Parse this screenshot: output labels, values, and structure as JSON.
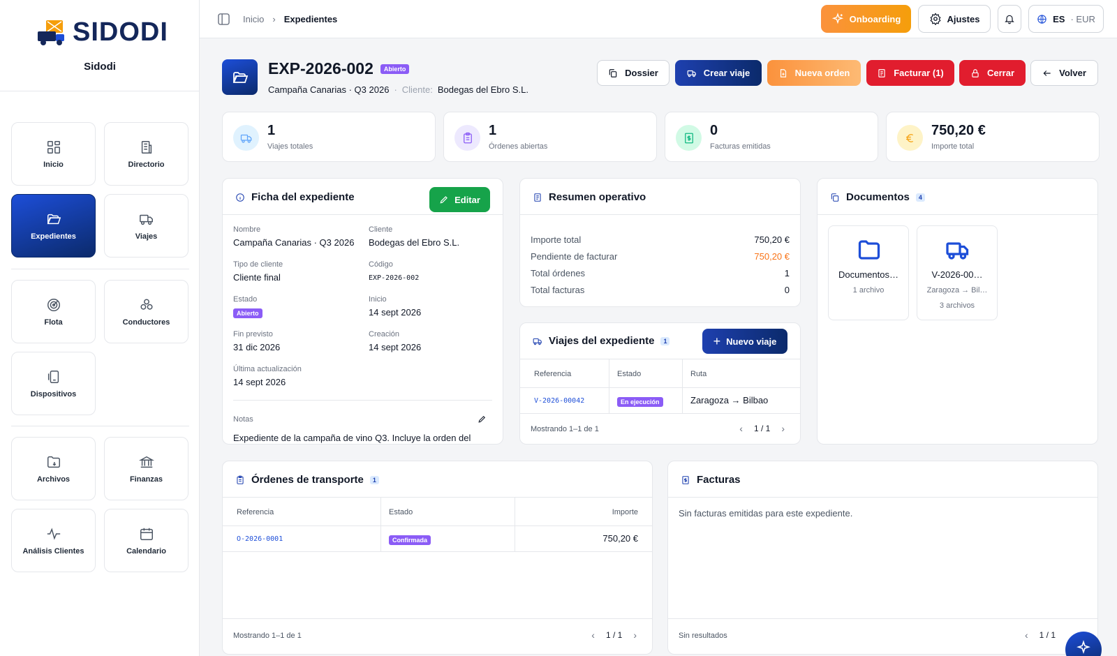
{
  "app": {
    "logo_text": "SIDODI",
    "brand_name": "Sidodi"
  },
  "nav": [
    {
      "label": "Inicio",
      "icon": "dashboard-icon",
      "active": false
    },
    {
      "label": "Directorio",
      "icon": "building-icon",
      "active": false
    },
    {
      "label": "Expedientes",
      "icon": "folder-open-icon",
      "active": true
    },
    {
      "label": "Viajes",
      "icon": "truck-icon",
      "active": false
    },
    {
      "label": "Flota",
      "icon": "radar-icon",
      "active": false
    },
    {
      "label": "Conductores",
      "icon": "people-icon",
      "active": false
    },
    {
      "label": "Dispositivos",
      "icon": "device-icon",
      "active": false
    },
    {
      "label": "Archivos",
      "icon": "folder-file-icon",
      "active": false
    },
    {
      "label": "Finanzas",
      "icon": "bank-icon",
      "active": false
    },
    {
      "label": "Análisis Clientes",
      "icon": "activity-icon",
      "active": false
    },
    {
      "label": "Calendario",
      "icon": "calendar-icon",
      "active": false
    }
  ],
  "topbar": {
    "breadcrumb": [
      "Inicio",
      "Expedientes"
    ],
    "onboarding_label": "Onboarding",
    "settings_label": "Ajustes",
    "language": "ES",
    "currency": "· EUR"
  },
  "header": {
    "title": "EXP-2026-002",
    "status": "Abierto",
    "subtitle": "Campaña Canarias · Q3 2026",
    "separator": "·",
    "client_label": "Cliente:",
    "client": "Bodegas del Ebro S.L."
  },
  "actions": {
    "dossier": "Dossier",
    "crear_viaje": "Crear viaje",
    "nueva_orden": "Nueva orden",
    "facturar": "Facturar (1)",
    "cerrar": "Cerrar",
    "volver": "Volver"
  },
  "stats": [
    {
      "value": "1",
      "label": "Viajes totales",
      "icon": "truck-icon",
      "color": "#60a5fa"
    },
    {
      "value": "1",
      "label": "Órdenes abiertas",
      "icon": "clipboard-icon",
      "color": "#8b5cf6"
    },
    {
      "value": "0",
      "label": "Facturas emitidas",
      "icon": "invoice-icon",
      "color": "#10b981"
    },
    {
      "value": "750,20 €",
      "label": "Importe total",
      "icon": "euro-icon",
      "color": "#f59e0b"
    }
  ],
  "ficha": {
    "title": "Ficha del expediente",
    "edit_label": "Editar",
    "fields": {
      "nombre": {
        "label": "Nombre",
        "value": "Campaña Canarias · Q3 2026"
      },
      "cliente": {
        "label": "Cliente",
        "value": "Bodegas del Ebro S.L."
      },
      "tipo": {
        "label": "Tipo de cliente",
        "value": "Cliente final"
      },
      "codigo": {
        "label": "Código",
        "value": "EXP-2026-002"
      },
      "estado": {
        "label": "Estado",
        "value": "Abierto"
      },
      "inicio": {
        "label": "Inicio",
        "value": "14 sept 2026"
      },
      "fin": {
        "label": "Fin previsto",
        "value": "31 dic 2026"
      },
      "creacion": {
        "label": "Creación",
        "value": "14 sept 2026"
      },
      "actualizacion": {
        "label": "Última actualización",
        "value": "14 sept 2026"
      }
    },
    "notes_label": "Notas",
    "notes": "Expediente de la campaña de vino Q3. Incluye la orden del"
  },
  "resumen": {
    "title": "Resumen operativo",
    "rows": [
      {
        "label": "Importe total",
        "value": "750,20 €",
        "highlight": false
      },
      {
        "label": "Pendiente de facturar",
        "value": "750,20 €",
        "highlight": true
      },
      {
        "label": "Total órdenes",
        "value": "1",
        "highlight": false
      },
      {
        "label": "Total facturas",
        "value": "0",
        "highlight": false
      }
    ]
  },
  "viajes": {
    "title": "Viajes del expediente",
    "count": "1",
    "new_label": "Nuevo viaje",
    "columns": [
      "Referencia",
      "Estado",
      "Ruta"
    ],
    "rows": [
      {
        "ref": "V-2026-00042",
        "estado": "En ejecución",
        "ruta": "Zaragoza → Bilbao"
      }
    ],
    "showing": "Mostrando 1–1 de 1",
    "page": "1 / 1"
  },
  "documentos": {
    "title": "Documentos",
    "count": "4",
    "items": [
      {
        "name": "Documentos…",
        "meta1": "1 archivo",
        "meta2": "",
        "icon": "folder-icon"
      },
      {
        "name": "V-2026-00…",
        "meta1": "Zaragoza → Bil…",
        "meta2": "3 archivos",
        "icon": "truck-icon"
      }
    ]
  },
  "ordenes": {
    "title": "Órdenes de transporte",
    "count": "1",
    "columns": [
      "Referencia",
      "Estado",
      "Importe"
    ],
    "rows": [
      {
        "ref": "O-2026-0001",
        "estado": "Confirmada",
        "importe": "750,20 €"
      }
    ],
    "showing": "Mostrando 1–1 de 1",
    "page": "1 / 1"
  },
  "facturas": {
    "title": "Facturas",
    "empty": "Sin facturas emitidas para este expediente.",
    "footer": "Sin resultados",
    "page": "1 / 1"
  },
  "colors": {
    "primary": "#0b2a6b",
    "accent_orange": "#fb923c",
    "danger": "#e11d2e",
    "success": "#16a34a",
    "badge_purple": "#8b5cf6"
  }
}
